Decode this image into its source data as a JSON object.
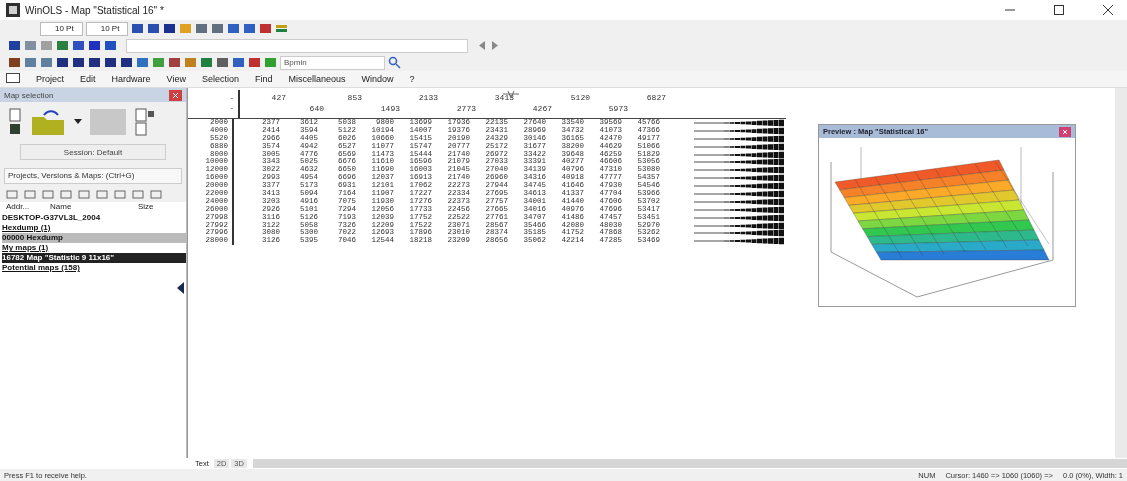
{
  "window": {
    "title": "WinOLS - Map \"Statistical 16\" *"
  },
  "toolbar": {
    "font_size_1": "10 Pt",
    "font_size_2": "10 Pt",
    "search_field": "Bpmin"
  },
  "menu": [
    "Project",
    "Edit",
    "Hardware",
    "View",
    "Selection",
    "Find",
    "Miscellaneous",
    "Window",
    "?"
  ],
  "map_selection": {
    "title": "Map selection",
    "session_button": "Session: Default",
    "projects_field": "Projects, Versions & Maps: (Ctrl+G)",
    "columns": [
      "Addr...",
      "Name",
      "Size"
    ],
    "tree": [
      {
        "label": "DESKTOP-G37VL3L_2004",
        "kind": "project",
        "selected": false
      },
      {
        "label": "Hexdump (1)",
        "kind": "group",
        "selected": false
      },
      {
        "label": "00000   Hexdump",
        "kind": "map",
        "selected": false
      },
      {
        "label": "My maps (1)",
        "kind": "group",
        "selected": false
      },
      {
        "label": "16782   Map \"Statistic 9 11x16\"",
        "kind": "map",
        "selected": true
      },
      {
        "label": "Potential maps (158)",
        "kind": "group",
        "selected": false
      }
    ]
  },
  "table": {
    "corner": [
      "-",
      "-"
    ],
    "columns": [
      "427",
      "640",
      "853",
      "1493",
      "2133",
      "2773",
      "3413",
      "4267",
      "5120",
      "5973",
      "6827"
    ],
    "rows": [
      {
        "label": "2000",
        "values": [
          "2377",
          "3612",
          "5038",
          "9800",
          "13699",
          "17936",
          "22135",
          "27640",
          "33540",
          "39569",
          "45766"
        ]
      },
      {
        "label": "4000",
        "values": [
          "2414",
          "3594",
          "5122",
          "10194",
          "14007",
          "19376",
          "23431",
          "28969",
          "34732",
          "41073",
          "47366"
        ]
      },
      {
        "label": "5520",
        "values": [
          "2966",
          "4405",
          "6026",
          "10660",
          "15415",
          "20190",
          "24329",
          "30146",
          "36165",
          "42470",
          "49177"
        ]
      },
      {
        "label": "6880",
        "values": [
          "3574",
          "4942",
          "6527",
          "11077",
          "15747",
          "20777",
          "25172",
          "31677",
          "38200",
          "44629",
          "51066"
        ]
      },
      {
        "label": "8000",
        "values": [
          "3005",
          "4776",
          "6569",
          "11473",
          "15444",
          "21740",
          "26972",
          "33422",
          "39648",
          "46259",
          "51829"
        ]
      },
      {
        "label": "10000",
        "values": [
          "3343",
          "5025",
          "6676",
          "11610",
          "16596",
          "21079",
          "27033",
          "33391",
          "40277",
          "46606",
          "53056"
        ]
      },
      {
        "label": "12000",
        "values": [
          "3022",
          "4632",
          "6650",
          "11690",
          "16003",
          "21045",
          "27040",
          "34139",
          "40796",
          "47310",
          "53080"
        ]
      },
      {
        "label": "16000",
        "values": [
          "2993",
          "4954",
          "6696",
          "12037",
          "16913",
          "21740",
          "26960",
          "34316",
          "40918",
          "47777",
          "54357"
        ]
      },
      {
        "label": "20000",
        "values": [
          "3377",
          "5173",
          "6931",
          "12101",
          "17062",
          "22273",
          "27944",
          "34745",
          "41646",
          "47930",
          "54546"
        ]
      },
      {
        "label": "22000",
        "values": [
          "3413",
          "5094",
          "7164",
          "11907",
          "17227",
          "22334",
          "27695",
          "34613",
          "41337",
          "47704",
          "53966"
        ]
      },
      {
        "label": "24000",
        "values": [
          "3203",
          "4916",
          "7075",
          "11930",
          "17276",
          "22373",
          "27757",
          "34001",
          "41440",
          "47606",
          "53702"
        ]
      },
      {
        "label": "26000",
        "values": [
          "2926",
          "5101",
          "7294",
          "12056",
          "17733",
          "22456",
          "27665",
          "34016",
          "40976",
          "47696",
          "53417"
        ]
      },
      {
        "label": "27998",
        "values": [
          "3116",
          "5126",
          "7193",
          "12039",
          "17752",
          "22522",
          "27761",
          "34707",
          "41486",
          "47457",
          "53451"
        ]
      },
      {
        "label": "27992",
        "values": [
          "3122",
          "5058",
          "7326",
          "12209",
          "17522",
          "23071",
          "28567",
          "35466",
          "42080",
          "48030",
          "52970"
        ]
      },
      {
        "label": "27996",
        "values": [
          "3080",
          "5300",
          "7022",
          "12693",
          "17896",
          "23010",
          "28374",
          "35185",
          "41752",
          "47868",
          "53262"
        ]
      },
      {
        "label": "28000",
        "values": [
          "3126",
          "5395",
          "7046",
          "12544",
          "18218",
          "23209",
          "28656",
          "35062",
          "42214",
          "47285",
          "53469"
        ]
      }
    ]
  },
  "preview": {
    "title": "Preview : Map \"Statistical 16\""
  },
  "view_tabs": [
    {
      "label": "Text",
      "selected": true
    },
    {
      "label": "2D",
      "selected": false
    },
    {
      "label": "3D",
      "selected": false
    }
  ],
  "status_bar": {
    "help": "Press F1 to receive help.",
    "mode": "NUM",
    "cursor": "Cursor: 1460 => 1060 (1060) =>",
    "info": "0.0 (0%), Width: 1"
  }
}
